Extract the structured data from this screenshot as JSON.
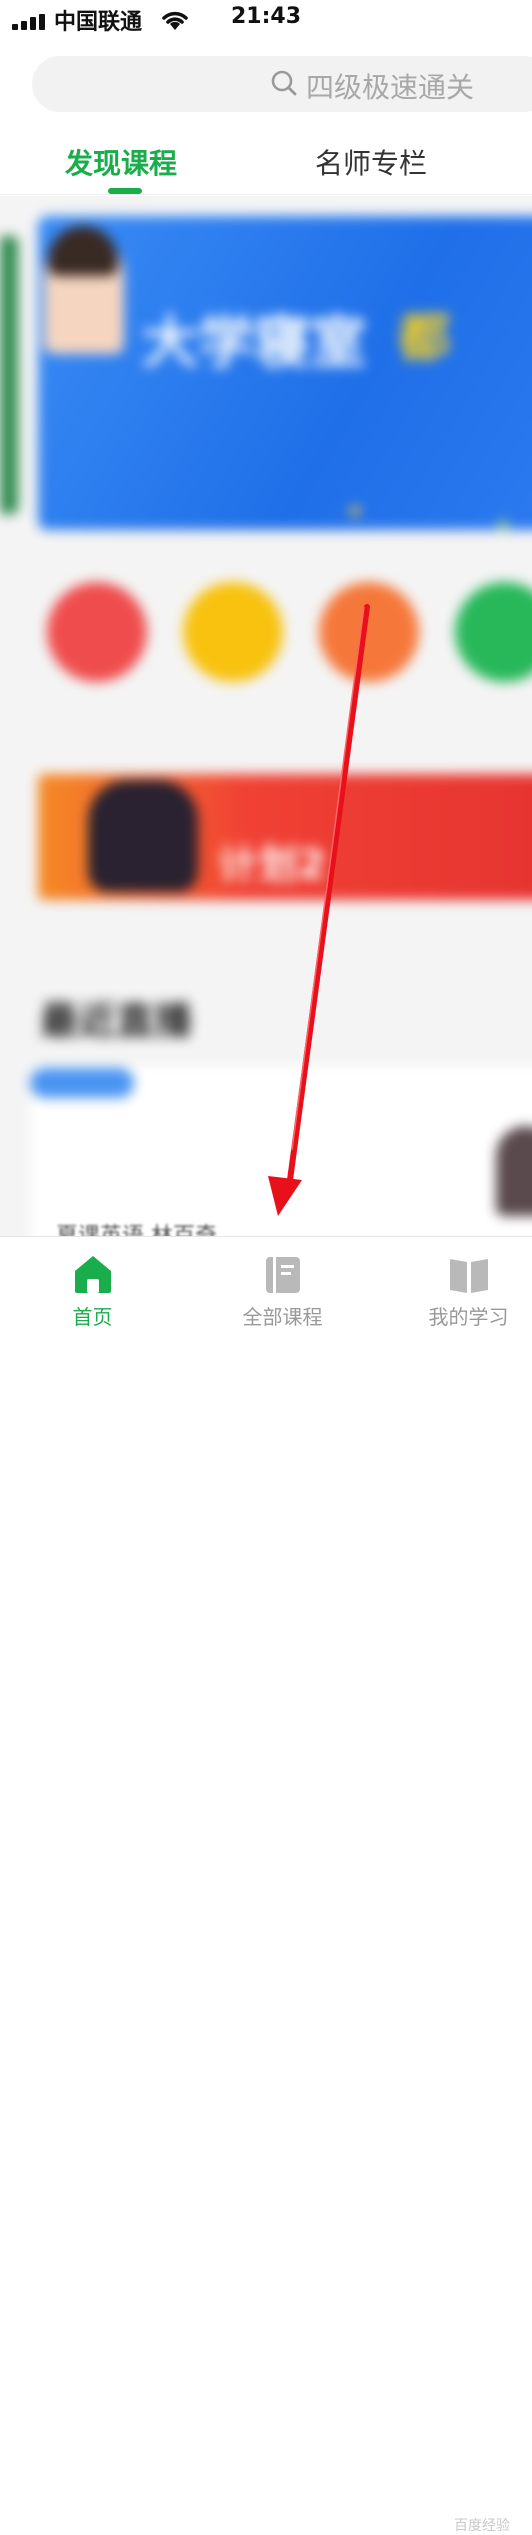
{
  "status_bar": {
    "carrier": "中国联通",
    "time": "21:43"
  },
  "search": {
    "placeholder": "四级极速通关"
  },
  "top_tabs": [
    {
      "label": "发现课程",
      "active": true
    },
    {
      "label": "名师专栏",
      "active": false
    }
  ],
  "banner": {
    "title": "大学寝室",
    "highlight": "都",
    "colors": {
      "bg": "#1f6fe8",
      "title": "#ffffff",
      "highlight": "#ffd21a"
    }
  },
  "category_icons": [
    {
      "icon": "crown-icon",
      "color": "#ef4d4d"
    },
    {
      "icon": "gift-box-icon",
      "color": "#f8c20f"
    },
    {
      "icon": "play-icon",
      "color": "#f5783a"
    },
    {
      "icon": "user-icon",
      "color": "#28b85a"
    }
  ],
  "promo": {
    "big_text": "计划2",
    "colors": {
      "from": "#f58a26",
      "to": "#e63330"
    }
  },
  "section": {
    "title": "最近直播"
  },
  "live_card": {
    "teacher": "夏课英语 林百奇"
  },
  "bottom_nav": [
    {
      "label": "首页",
      "icon": "home-icon",
      "active": true
    },
    {
      "label": "全部课程",
      "icon": "book-icon",
      "active": false
    },
    {
      "label": "我的学习",
      "icon": "open-book-icon",
      "active": false
    }
  ],
  "watermark": "百度经验",
  "colors": {
    "accent": "#1aad4b",
    "arrow": "#e8101a"
  }
}
